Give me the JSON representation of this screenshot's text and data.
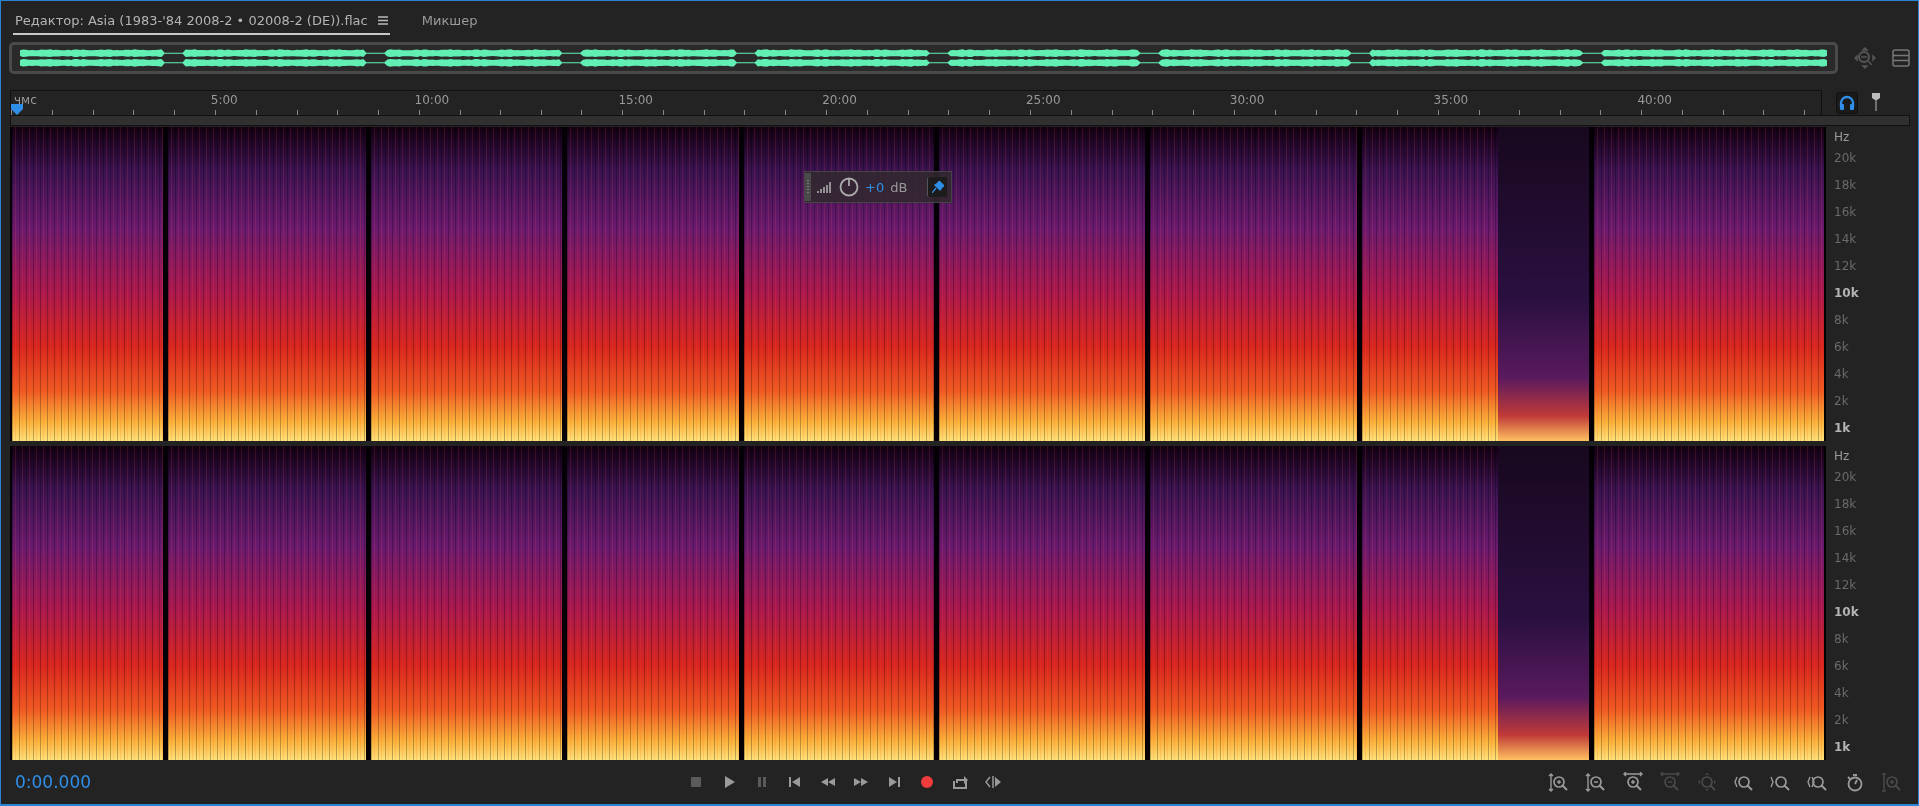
{
  "tabs": [
    {
      "label": "Редактор: Asia (1983-'84 2008-2 • 02008-2 (DE)).flac",
      "selected": true,
      "has_menu": true
    },
    {
      "label": "Микшер",
      "selected": false,
      "has_menu": false
    }
  ],
  "ruler": {
    "labels": [
      "чмс",
      "5:00",
      "10:00",
      "15:00",
      "20:00",
      "25:00",
      "30:00",
      "35:00",
      "40:00"
    ]
  },
  "hud": {
    "value": "+0",
    "unit": "dB"
  },
  "channels": [
    {
      "unit": "Hz",
      "ticks": [
        {
          "label": "20k",
          "major": false
        },
        {
          "label": "18k",
          "major": false
        },
        {
          "label": "16k",
          "major": false
        },
        {
          "label": "14k",
          "major": false
        },
        {
          "label": "12k",
          "major": false
        },
        {
          "label": "10k",
          "major": true
        },
        {
          "label": "8k",
          "major": false
        },
        {
          "label": "6k",
          "major": false
        },
        {
          "label": "4k",
          "major": false
        },
        {
          "label": "2k",
          "major": false
        },
        {
          "label": "1k",
          "major": true
        }
      ]
    },
    {
      "unit": "Hz",
      "ticks": [
        {
          "label": "20k",
          "major": false
        },
        {
          "label": "18k",
          "major": false
        },
        {
          "label": "16k",
          "major": false
        },
        {
          "label": "14k",
          "major": false
        },
        {
          "label": "12k",
          "major": false
        },
        {
          "label": "10k",
          "major": true
        },
        {
          "label": "8k",
          "major": false
        },
        {
          "label": "6k",
          "major": false
        },
        {
          "label": "4k",
          "major": false
        },
        {
          "label": "2k",
          "major": false
        },
        {
          "label": "1k",
          "major": true
        }
      ]
    }
  ],
  "time": "0:00.000",
  "transport": [
    {
      "kind": "stop",
      "disabled": true
    },
    {
      "kind": "play",
      "disabled": false
    },
    {
      "kind": "pause",
      "disabled": true
    },
    {
      "kind": "prev",
      "disabled": false
    },
    {
      "kind": "rewind",
      "disabled": false
    },
    {
      "kind": "forward",
      "disabled": false
    },
    {
      "kind": "next",
      "disabled": false
    },
    {
      "kind": "record",
      "disabled": false
    },
    {
      "kind": "loop",
      "disabled": false
    },
    {
      "kind": "skip",
      "disabled": false
    }
  ],
  "zoom": [
    {
      "kind": "amp-in",
      "disabled": false
    },
    {
      "kind": "amp-out",
      "disabled": false
    },
    {
      "kind": "time-in",
      "disabled": false
    },
    {
      "kind": "time-out",
      "disabled": true
    },
    {
      "kind": "full",
      "disabled": true
    },
    {
      "kind": "left",
      "disabled": false
    },
    {
      "kind": "right",
      "disabled": false
    },
    {
      "kind": "both",
      "disabled": false
    },
    {
      "kind": "timer",
      "disabled": false
    },
    {
      "kind": "amp-fit",
      "disabled": true
    }
  ]
}
